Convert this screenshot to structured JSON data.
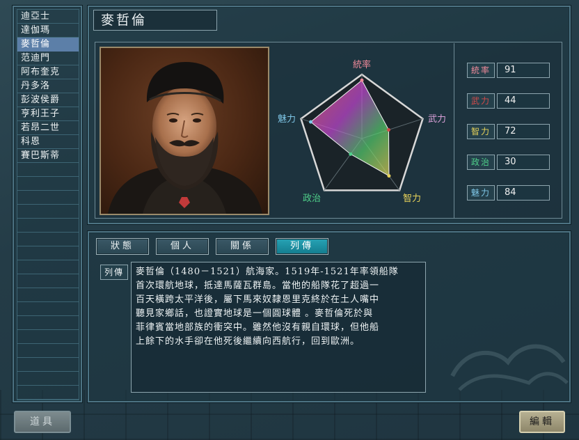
{
  "names": [
    "迪亞士",
    "達伽瑪",
    "麥哲倫",
    "范迪門",
    "阿布奎克",
    "丹多洛",
    "彭波侯爵",
    "亨利王子",
    "若昂二世",
    "科恩",
    "賽巴斯蒂"
  ],
  "selected_index": 2,
  "character_name": "麥哲倫",
  "radar": {
    "labels": {
      "command": "統率",
      "force": "武力",
      "intellect": "智力",
      "politics": "政治",
      "charm": "魅力"
    },
    "max": 100
  },
  "stats": [
    {
      "label": "統率",
      "value": "91",
      "color": "#ef8a9a"
    },
    {
      "label": "武力",
      "value": "44",
      "color": "#d24a4a"
    },
    {
      "label": "智力",
      "value": "72",
      "color": "#e8d35a"
    },
    {
      "label": "政治",
      "value": "30",
      "color": "#4fd08a"
    },
    {
      "label": "魅力",
      "value": "84",
      "color": "#7ec6e6"
    }
  ],
  "tabs": [
    "狀態",
    "個人",
    "關係",
    "列傳"
  ],
  "active_tab": 3,
  "bio_label": "列傳",
  "bio_lines": [
    "麥哲倫（1480－1521）航海家。1519年-1521年率領船隊",
    "首次環航地球，抵達馬薩瓦群島。當他的船隊花了超過一",
    "百天橫跨太平洋後，屬下馬來奴隸恩里克終於在土人嘴中",
    "聽見家鄉話，也證實地球是一個圓球體 。麥哲倫死於與",
    "菲律賓當地部族的衝突中。雖然他沒有親自環球，但他船",
    "上餘下的水手卻在他死後繼續向西航行，回到歐洲。"
  ],
  "buttons": {
    "items": "道具",
    "edit": "編輯"
  }
}
